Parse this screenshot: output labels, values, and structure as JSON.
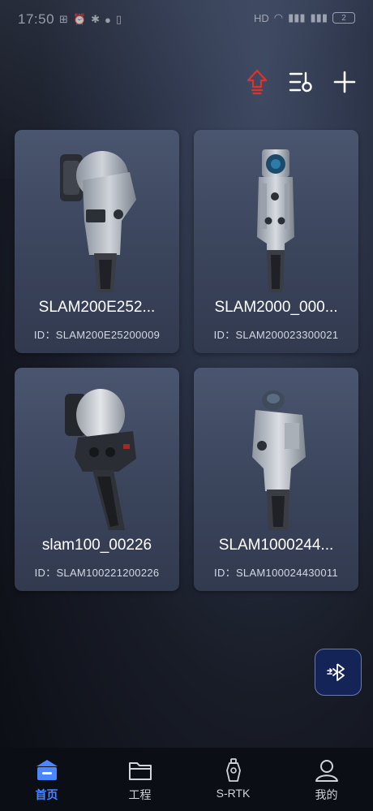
{
  "status_bar": {
    "time": "17:50",
    "left_glyphs": [
      "⊞",
      "⏰",
      "✱",
      "●",
      "▯"
    ],
    "right_glyphs": [
      "HD",
      "◠",
      "▮▮▮",
      "▮▮▮"
    ],
    "battery": "2"
  },
  "toolbar": {
    "upgrade_icon": "upgrade-arrow-icon",
    "filter_icon": "list-filter-icon",
    "add_icon": "plus-icon",
    "accent": "#e0312b"
  },
  "devices": [
    {
      "name": "SLAM200E252...",
      "id": "ID：SLAM200E25200009",
      "model": "slam200e"
    },
    {
      "name": "SLAM2000_000...",
      "id": "ID：SLAM200023300021",
      "model": "slam2000"
    },
    {
      "name": "slam100_00226",
      "id": "ID：SLAM100221200226",
      "model": "slam100"
    },
    {
      "name": "SLAM1000244...",
      "id": "ID：SLAM100024430011",
      "model": "slam1000"
    }
  ],
  "fab": {
    "icon": "bluetooth-icon"
  },
  "bottom_nav": {
    "items": [
      {
        "label": "首页",
        "icon": "home-icon",
        "active": true
      },
      {
        "label": "工程",
        "icon": "folder-icon",
        "active": false
      },
      {
        "label": "S-RTK",
        "icon": "rtk-receiver-icon",
        "active": false
      },
      {
        "label": "我的",
        "icon": "user-icon",
        "active": false
      }
    ],
    "active_color": "#4a86ff"
  }
}
